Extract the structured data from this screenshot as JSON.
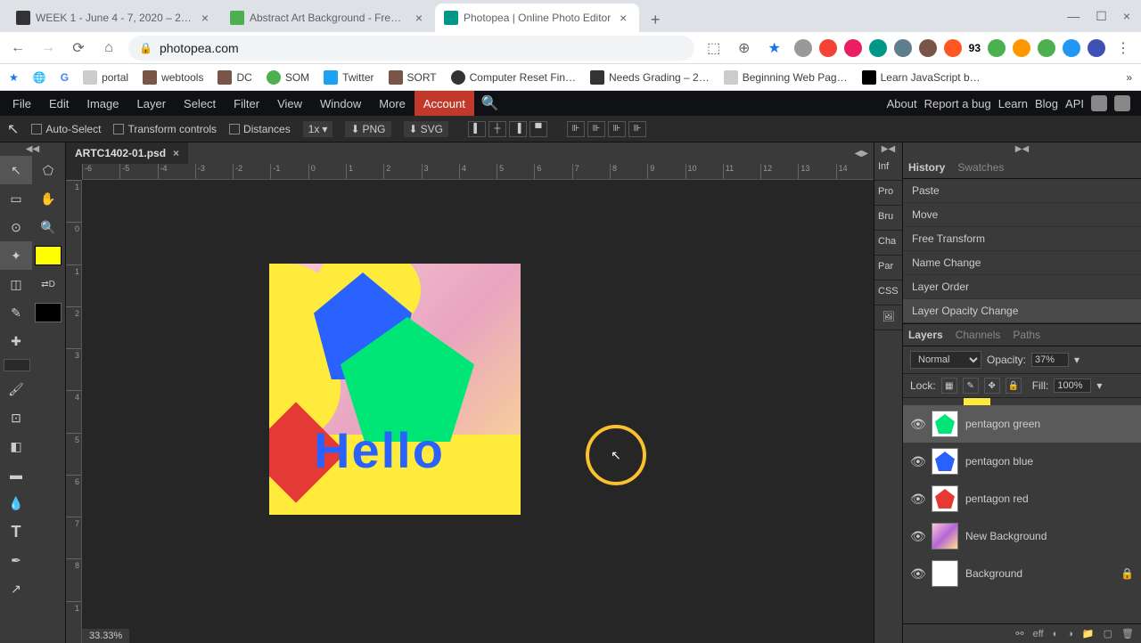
{
  "browser": {
    "tabs": [
      {
        "title": "WEEK 1 - June 4 - 7, 2020 – 202…",
        "icon": "#333"
      },
      {
        "title": "Abstract Art Background - Free …",
        "icon": "#4caf50"
      },
      {
        "title": "Photopea | Online Photo Editor",
        "icon": "#009688"
      }
    ],
    "url": "photopea.com",
    "ext_count": "93"
  },
  "bookmarks": [
    "portal",
    "webtools",
    "DC",
    "SOM",
    "Twitter",
    "SORT",
    "Computer Reset Fin…",
    "Needs Grading – 2…",
    "Beginning Web Pag…",
    "Learn JavaScript b…"
  ],
  "menu": [
    "File",
    "Edit",
    "Image",
    "Layer",
    "Select",
    "Filter",
    "View",
    "Window",
    "More"
  ],
  "menu_account": "Account",
  "menu_right": [
    "About",
    "Report a bug",
    "Learn",
    "Blog",
    "API"
  ],
  "options": {
    "auto_select": "Auto-Select",
    "transform": "Transform controls",
    "distances": "Distances",
    "zoom": "1x",
    "png": "PNG",
    "svg": "SVG"
  },
  "doc_tab": "ARTC1402-01.psd",
  "ruler_h": [
    "-6",
    "-5",
    "-4",
    "-3",
    "-2",
    "-1",
    "0",
    "1",
    "2",
    "3",
    "4",
    "5",
    "6",
    "7",
    "8",
    "9",
    "10",
    "11",
    "12",
    "13",
    "14"
  ],
  "ruler_v": [
    "1",
    "0",
    "1",
    "2",
    "3",
    "4",
    "5",
    "6",
    "7",
    "8",
    "1"
  ],
  "hello_text": "Hello",
  "zoom_pct": "33.33%",
  "minitabs": [
    "Inf",
    "Pro",
    "Bru",
    "Cha",
    "Par",
    "CSS"
  ],
  "history_tabs": [
    "History",
    "Swatches"
  ],
  "history": [
    "Paste",
    "Move",
    "Free Transform",
    "Name Change",
    "Layer Order",
    "Layer Opacity Change"
  ],
  "layers_tabs": [
    "Layers",
    "Channels",
    "Paths"
  ],
  "blend_mode": "Normal",
  "opacity_label": "Opacity:",
  "opacity_val": "37%",
  "lock_label": "Lock:",
  "fill_label": "Fill:",
  "fill_val": "100%",
  "layers": [
    {
      "name": "pentagon green",
      "color": "#00e676",
      "sel": true
    },
    {
      "name": "pentagon blue",
      "color": "#2962ff",
      "sel": false
    },
    {
      "name": "pentagon red",
      "color": "#e53935",
      "sel": false
    },
    {
      "name": "New Background",
      "bg": true,
      "sel": false
    },
    {
      "name": "Background",
      "white": true,
      "locked": true
    }
  ],
  "footer_eff": "eff",
  "d_label": "D"
}
